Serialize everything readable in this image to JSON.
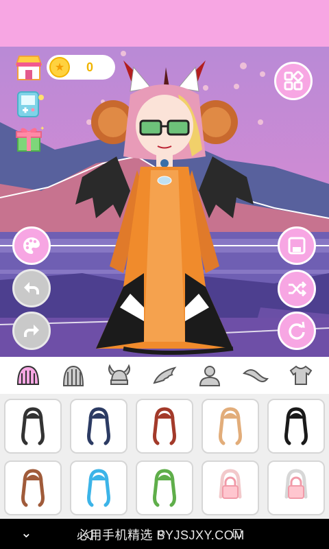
{
  "header": {
    "coin_value": "0"
  },
  "colors": {
    "accent": "#f7a6e3",
    "stage_top": "#b98ad6",
    "coin": "#ffd23f"
  },
  "top_left_icons": [
    "shop-icon",
    "coin-icon",
    "game-console-icon",
    "gift-icon"
  ],
  "right_buttons": [
    "grid-menu-icon",
    "save-icon",
    "shuffle-icon",
    "reset-icon"
  ],
  "left_buttons": [
    "palette-icon",
    "undo-icon",
    "redo-icon"
  ],
  "categories": [
    "hair-front",
    "hair-back",
    "headwear",
    "wings",
    "body",
    "tail",
    "clothing"
  ],
  "items": [
    {
      "hair": "#333333"
    },
    {
      "hair": "#2c3b63"
    },
    {
      "hair": "#a33a2a"
    },
    {
      "hair": "#e2ad7a"
    },
    {
      "hair": "#1a1a1a"
    },
    {
      "hair": "#a05b3a"
    },
    {
      "hair": "#3cb4e8"
    },
    {
      "hair": "#5fae4a"
    },
    {
      "hair": "#e9a5a8",
      "locked": true
    },
    {
      "hair": "#bdbdbd",
      "locked": true
    }
  ],
  "navbar": {
    "watermark": "必用手机精选 BYJSJXY.COM"
  }
}
